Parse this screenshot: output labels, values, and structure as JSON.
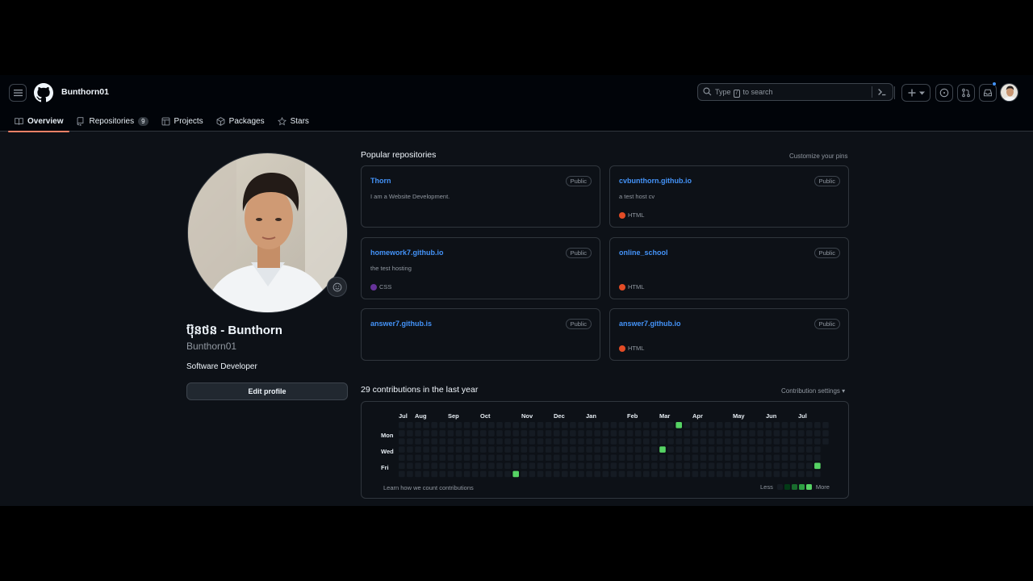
{
  "header": {
    "username": "Bunthorn01",
    "search_prefix": "Type",
    "search_key": "/",
    "search_suffix": "to search",
    "icons": [
      "hamburger-icon",
      "github-logo-icon",
      "search-icon",
      "command-palette-icon",
      "plus-icon",
      "issues-icon",
      "pull-requests-icon",
      "inbox-icon"
    ]
  },
  "tabs": [
    {
      "label": "Overview",
      "active": true
    },
    {
      "label": "Repositories",
      "counter": "9"
    },
    {
      "label": "Projects"
    },
    {
      "label": "Packages"
    },
    {
      "label": "Stars"
    }
  ],
  "profile": {
    "full_name": "ប៊ុនថន - Bunthorn",
    "login": "Bunthorn01",
    "bio": "Software Developer",
    "edit_label": "Edit profile"
  },
  "popular": {
    "title": "Popular repositories",
    "customize_label": "Customize your pins",
    "repos": [
      {
        "name": "Thorn",
        "visibility": "Public",
        "description": "I am a Website Development.",
        "language": ""
      },
      {
        "name": "cvbunthorn.github.io",
        "visibility": "Public",
        "description": "a test host cv",
        "language": "HTML",
        "lang_color": "#e34c26"
      },
      {
        "name": "homework7.github.io",
        "visibility": "Public",
        "description": "the test hosting",
        "language": "CSS",
        "lang_color": "#663399"
      },
      {
        "name": "online_school",
        "visibility": "Public",
        "description": "",
        "language": "HTML",
        "lang_color": "#e34c26"
      },
      {
        "name": "answer7.github.is",
        "visibility": "Public",
        "description": "",
        "language": ""
      },
      {
        "name": "answer7.github.io",
        "visibility": "Public",
        "description": "",
        "language": "HTML",
        "lang_color": "#e34c26"
      }
    ]
  },
  "contributions": {
    "title": "29 contributions in the last year",
    "settings_label": "Contribution settings ▾",
    "months": [
      "Jul",
      "Aug",
      "Sep",
      "Oct",
      "Nov",
      "Dec",
      "Jan",
      "Feb",
      "Mar",
      "Apr",
      "May",
      "Jun",
      "Jul"
    ],
    "days": [
      "Mon",
      "Wed",
      "Fri"
    ],
    "learn_label": "Learn how we count contributions",
    "less_label": "Less",
    "more_label": "More",
    "level_colors": [
      "#151b23",
      "#033a16",
      "#196c2e",
      "#2ea043",
      "#56d364"
    ],
    "active_cells": [
      {
        "week": 14,
        "day": 6,
        "level": 4
      },
      {
        "week": 32,
        "day": 3,
        "level": 4
      },
      {
        "week": 34,
        "day": 0,
        "level": 4
      },
      {
        "week": 51,
        "day": 5,
        "level": 4
      }
    ]
  }
}
